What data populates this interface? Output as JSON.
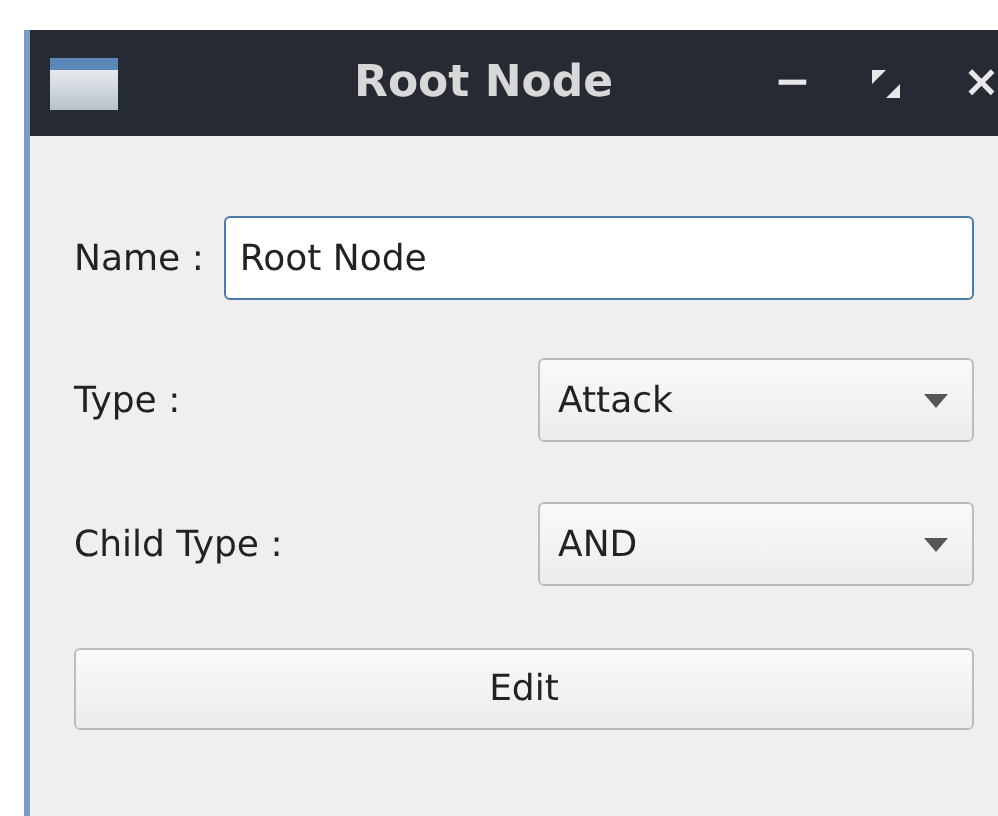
{
  "window": {
    "title": "Root Node",
    "minimize": "−",
    "close": "×"
  },
  "form": {
    "name_label": "Name :",
    "name_value": "Root Node",
    "type_label": "Type :",
    "type_value": "Attack",
    "child_type_label": "Child Type :",
    "child_type_value": "AND"
  },
  "buttons": [
    "Edit"
  ]
}
